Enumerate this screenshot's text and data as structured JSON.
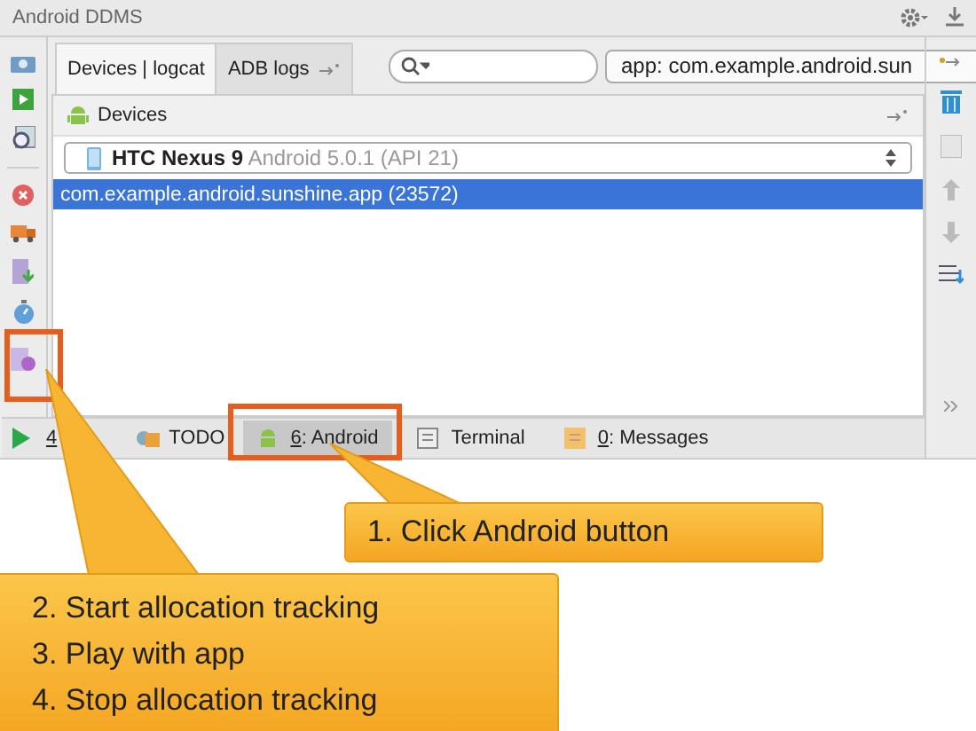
{
  "window": {
    "title": "Android DDMS"
  },
  "tabs": [
    {
      "label": "Devices | logcat",
      "selected": true
    },
    {
      "label": "ADB logs",
      "selected": false
    }
  ],
  "app_filter": {
    "value": "app: com.example.android.sun"
  },
  "devices": {
    "title": "Devices",
    "device": {
      "name": "HTC Nexus 9",
      "detail": "Android 5.0.1 (API 21)"
    },
    "processes": [
      {
        "label": "com.example.android.sunshine.app (23572)",
        "selected": true
      }
    ]
  },
  "bottom_tabs": [
    {
      "label": "4",
      "kind": "run",
      "selected": false
    },
    {
      "label": "TODO",
      "kind": "todo",
      "selected": false
    },
    {
      "label": "6: Android",
      "kind": "android",
      "selected": true
    },
    {
      "label": "Terminal",
      "kind": "terminal",
      "selected": false
    },
    {
      "label": "0: Messages",
      "kind": "messages",
      "selected": false
    }
  ],
  "callouts": [
    {
      "lines": [
        "1. Click Android button"
      ]
    },
    {
      "lines": [
        "2. Start allocation tracking",
        "3. Play with app",
        "4. Stop allocation tracking"
      ]
    }
  ]
}
